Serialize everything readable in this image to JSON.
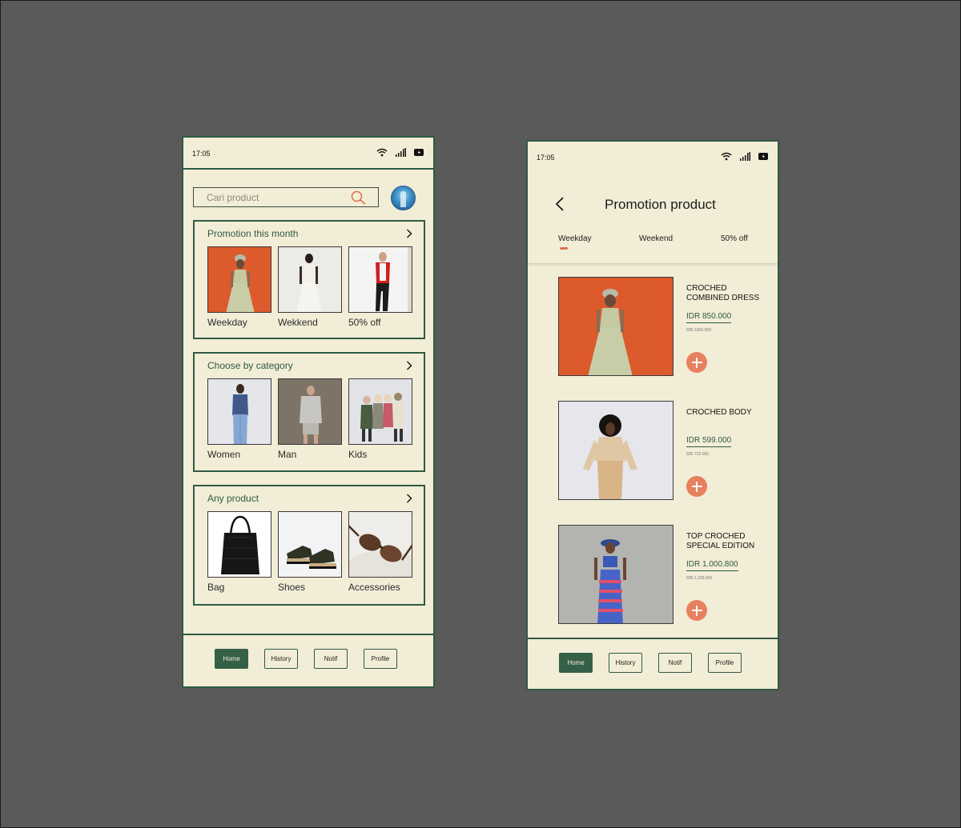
{
  "home": {
    "status": {
      "time": "17:05"
    },
    "search": {
      "placeholder": "Cari product"
    },
    "sections": [
      {
        "title": "Promotion this month",
        "items": [
          "Weekday",
          "Wekkend",
          "50% off"
        ]
      },
      {
        "title": "Choose by category",
        "items": [
          "Women",
          "Man",
          "Kids"
        ]
      },
      {
        "title": "Any product",
        "items": [
          "Bag",
          "Shoes",
          "Accessories"
        ]
      }
    ],
    "nav": [
      "Home",
      "History",
      "Notif",
      "Profile"
    ],
    "active_nav": "Home"
  },
  "promo": {
    "status": {
      "time": "17:05"
    },
    "title": "Promotion product",
    "tabs": [
      "Weekday",
      "Weekend",
      "50% off"
    ],
    "active_tab": "Weekday",
    "products": [
      {
        "name": "CROCHED COMBINED DRESS",
        "price": "IDR 850.000",
        "old_price": "IDR 1000.000"
      },
      {
        "name": "CROCHED BODY",
        "price": "IDR 599.000",
        "old_price": "IDR 723.000"
      },
      {
        "name": "TOP CROCHED SPECIAL EDITION",
        "price": "IDR 1.000.800",
        "old_price": "IDR 1.299.000"
      }
    ],
    "nav": [
      "Home",
      "History",
      "Notif",
      "Profile"
    ],
    "active_nav": "Home"
  },
  "colors": {
    "background": "#5a5a5a",
    "phone_bg": "#f2edd6",
    "primary_green": "#2f5a46",
    "accent_orange": "#e7805e"
  },
  "icons": [
    "wifi-icon",
    "signal-icon",
    "battery-icon",
    "search-icon",
    "chevron-right-icon",
    "back-arrow-icon",
    "add-icon"
  ]
}
